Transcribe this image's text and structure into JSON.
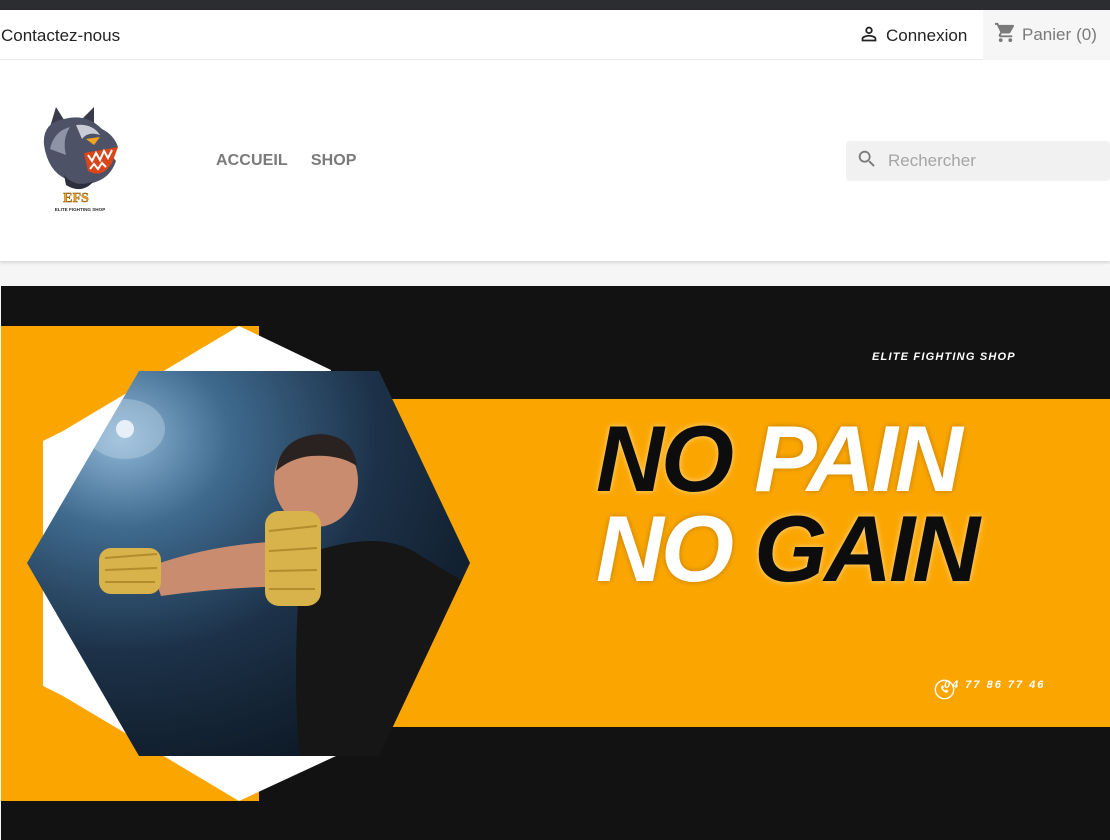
{
  "topbar": {
    "contact_label": "Contactez-nous",
    "login_label": "Connexion",
    "cart_label": "Panier",
    "cart_count": "(0)",
    "user_icon": "user-icon",
    "cart_icon": "shopping-cart-icon"
  },
  "header": {
    "logo_text": "EFS",
    "logo_subtext": "ELITE FIGHTING SHOP",
    "nav": [
      {
        "label": "Accueil"
      },
      {
        "label": "Shop"
      }
    ],
    "search": {
      "placeholder": "Rechercher",
      "icon": "search-icon"
    }
  },
  "banner": {
    "brand": "ELITE FIGHTING SHOP",
    "slogan_line1_word1": "NO",
    "slogan_line1_word2": "PAIN",
    "slogan_line2_word1": "NO",
    "slogan_line2_word2": "GAIN",
    "phone": "04 77 86 77 46",
    "phone_icon": "phone-icon",
    "image": "boxer-with-hand-wraps-photo"
  },
  "colors": {
    "accent_orange": "#fba600",
    "banner_dark": "#121212",
    "logo_orange": "#f4a41c",
    "cart_bg": "#f6f6f6",
    "search_bg": "#f1f1f1"
  }
}
